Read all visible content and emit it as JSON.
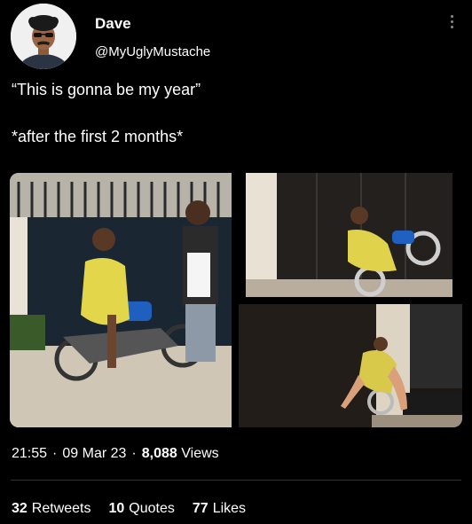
{
  "tweet": {
    "author_name": "Dave",
    "author_handle": "@MyUglyMustache",
    "text_line1": "“This is gonna be my year”",
    "text_line2": "*after the first 2 months*",
    "time": "21:55",
    "date": "09 Mar 23",
    "views_count": "8,088",
    "views_label": "Views",
    "separator": "·"
  },
  "stats": {
    "retweets_count": "32",
    "retweets_label": "Retweets",
    "quotes_count": "10",
    "quotes_label": "Quotes",
    "likes_count": "77",
    "likes_label": "Likes"
  },
  "icons": {
    "more": "more-vertical-icon"
  }
}
